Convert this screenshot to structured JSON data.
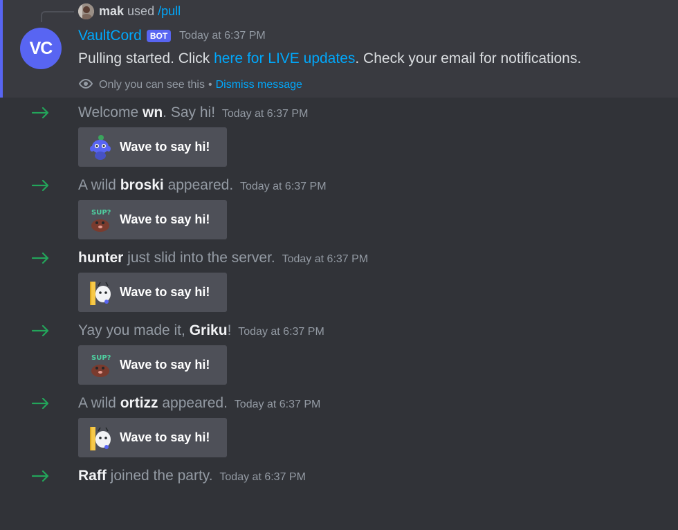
{
  "command": {
    "user": "mak",
    "used_text": "used",
    "slash": "/pull"
  },
  "bot_message": {
    "avatar_text": "VC",
    "name": "VaultCord",
    "tag": "BOT",
    "time": "Today at 6:37 PM",
    "text_before": "Pulling started. Click ",
    "link_text": "here for LIVE updates",
    "text_after": ". Check your email for notifications.",
    "only_you": "Only you can see this",
    "separator": "•",
    "dismiss": "Dismiss message"
  },
  "joins": [
    {
      "pre": "Welcome ",
      "name": "wn",
      "post": ". Say hi!",
      "time": "Today at 6:37 PM",
      "button": "Wave to say hi!",
      "sticker": "wumpus-icon"
    },
    {
      "pre": "A wild ",
      "name": "broski",
      "post": " appeared.",
      "time": "Today at 6:37 PM",
      "button": "Wave to say hi!",
      "sticker": "sup-mole-icon"
    },
    {
      "pre": "",
      "name": "hunter",
      "post": " just slid into the server.",
      "time": "Today at 6:37 PM",
      "button": "Wave to say hi!",
      "sticker": "ghost-door-icon"
    },
    {
      "pre": "Yay you made it, ",
      "name": "Griku",
      "post": "!",
      "time": "Today at 6:37 PM",
      "button": "Wave to say hi!",
      "sticker": "sup-mole-icon"
    },
    {
      "pre": "A wild ",
      "name": "ortizz",
      "post": " appeared.",
      "time": "Today at 6:37 PM",
      "button": "Wave to say hi!",
      "sticker": "ghost-door-icon"
    },
    {
      "pre": "",
      "name": "Raff",
      "post": " joined the party.",
      "time": "Today at 6:37 PM",
      "button": "",
      "sticker": ""
    }
  ],
  "colors": {
    "background": "#313338",
    "highlight": "#393a40",
    "accent": "#5865f2",
    "link": "#00a8fc",
    "arrow": "#23a55a",
    "button": "#4e5058"
  }
}
